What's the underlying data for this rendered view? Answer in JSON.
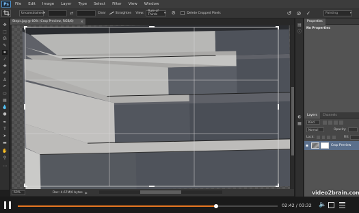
{
  "app": {
    "logo": "Ps"
  },
  "menu": [
    "File",
    "Edit",
    "Image",
    "Layer",
    "Type",
    "Select",
    "Filter",
    "View",
    "Window"
  ],
  "options": {
    "ratio": "Unconstrained",
    "swap_glyph": "⇄",
    "clear_label": "Clear",
    "straighten_label": "Straighten",
    "view_label": "View:",
    "view_value": "Rule of Thirds",
    "delete_cropped_label": "Delete Cropped Pixels",
    "workspace": "Painting"
  },
  "document": {
    "tab_title": "Steps.jpg @ 60% (Crop Preview, RGB/8)",
    "zoom": "60%",
    "doc_info": "Doc: 4.67M/0 bytes"
  },
  "panels": {
    "properties_tab": "Properties",
    "properties_empty": "No Properties",
    "layers_tab": "Layers",
    "channels_tab": "Channels",
    "filter_kind": "Kind",
    "blend_mode": "Normal",
    "opacity_label": "Opacity:",
    "lock_label": "Lock:",
    "fill_label": "Fill:",
    "layer_name": "Crop Preview"
  },
  "player": {
    "time": "02:42 / 03:32",
    "progress": 0.764,
    "brand": "video2brain.com"
  },
  "colors": {
    "accent": "#e87722",
    "layer_selected": "#5a6f8c"
  }
}
